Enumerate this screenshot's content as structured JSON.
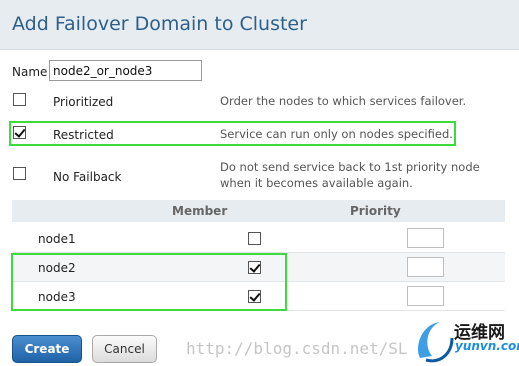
{
  "dialog": {
    "title": "Add Failover Domain to Cluster"
  },
  "name_field": {
    "label": "Name",
    "value": "node2_or_node3"
  },
  "options": [
    {
      "label": "Prioritized",
      "checked": false,
      "description": "Order the nodes to which services failover."
    },
    {
      "label": "Restricted",
      "checked": true,
      "description": "Service can run only on nodes specified."
    },
    {
      "label": "No Failback",
      "checked": false,
      "description_line1": "Do not send service back to 1st priority node",
      "description_line2": "when it becomes available again."
    }
  ],
  "table": {
    "headers": {
      "member": "Member",
      "priority": "Priority"
    },
    "rows": [
      {
        "node": "node1",
        "member": false,
        "priority": ""
      },
      {
        "node": "node2",
        "member": true,
        "priority": ""
      },
      {
        "node": "node3",
        "member": true,
        "priority": ""
      }
    ]
  },
  "buttons": {
    "create": "Create",
    "cancel": "Cancel"
  },
  "watermark": {
    "text": "http://blog.csdn.net/SL",
    "logo_cn": "运维网",
    "logo_en": "yunvn.com"
  },
  "colors": {
    "accent": "#1f62a6",
    "highlight": "#3ddc3d",
    "title": "#2d5f8b"
  }
}
